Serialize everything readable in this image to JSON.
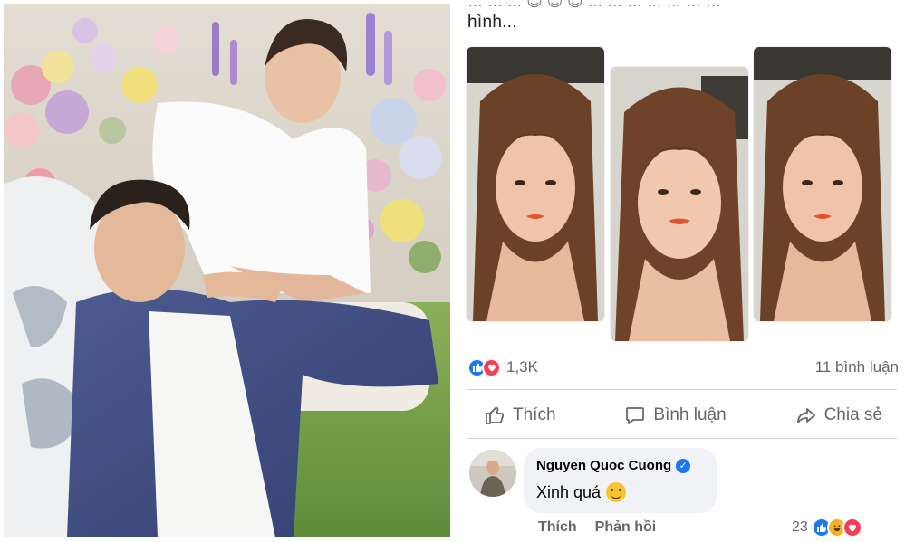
{
  "post": {
    "text_line": "hình...",
    "cut_text": "… … … 😊 😊 😊 … … … … … … …"
  },
  "reactions": {
    "icons": [
      "like-icon",
      "love-icon"
    ],
    "count": "1,3K",
    "comments": "11 bình luận"
  },
  "actions": {
    "like": "Thích",
    "comment": "Bình luận",
    "share": "Chia sẻ"
  },
  "comment": {
    "author": "Nguyen Quoc Cuong",
    "verified": true,
    "text": "Xinh quá",
    "emoji": "yum-emoji",
    "like_label": "Thích",
    "reply_label": "Phản hồi",
    "reaction_count": "23",
    "reaction_icons": [
      "like-icon",
      "haha-icon",
      "love-icon"
    ]
  },
  "colors": {
    "facebook_blue": "#1877f2",
    "love_red": "#f33e58",
    "haha_yellow": "#f7b125",
    "muted_text": "#65676b",
    "bubble_bg": "#f0f2f5"
  }
}
